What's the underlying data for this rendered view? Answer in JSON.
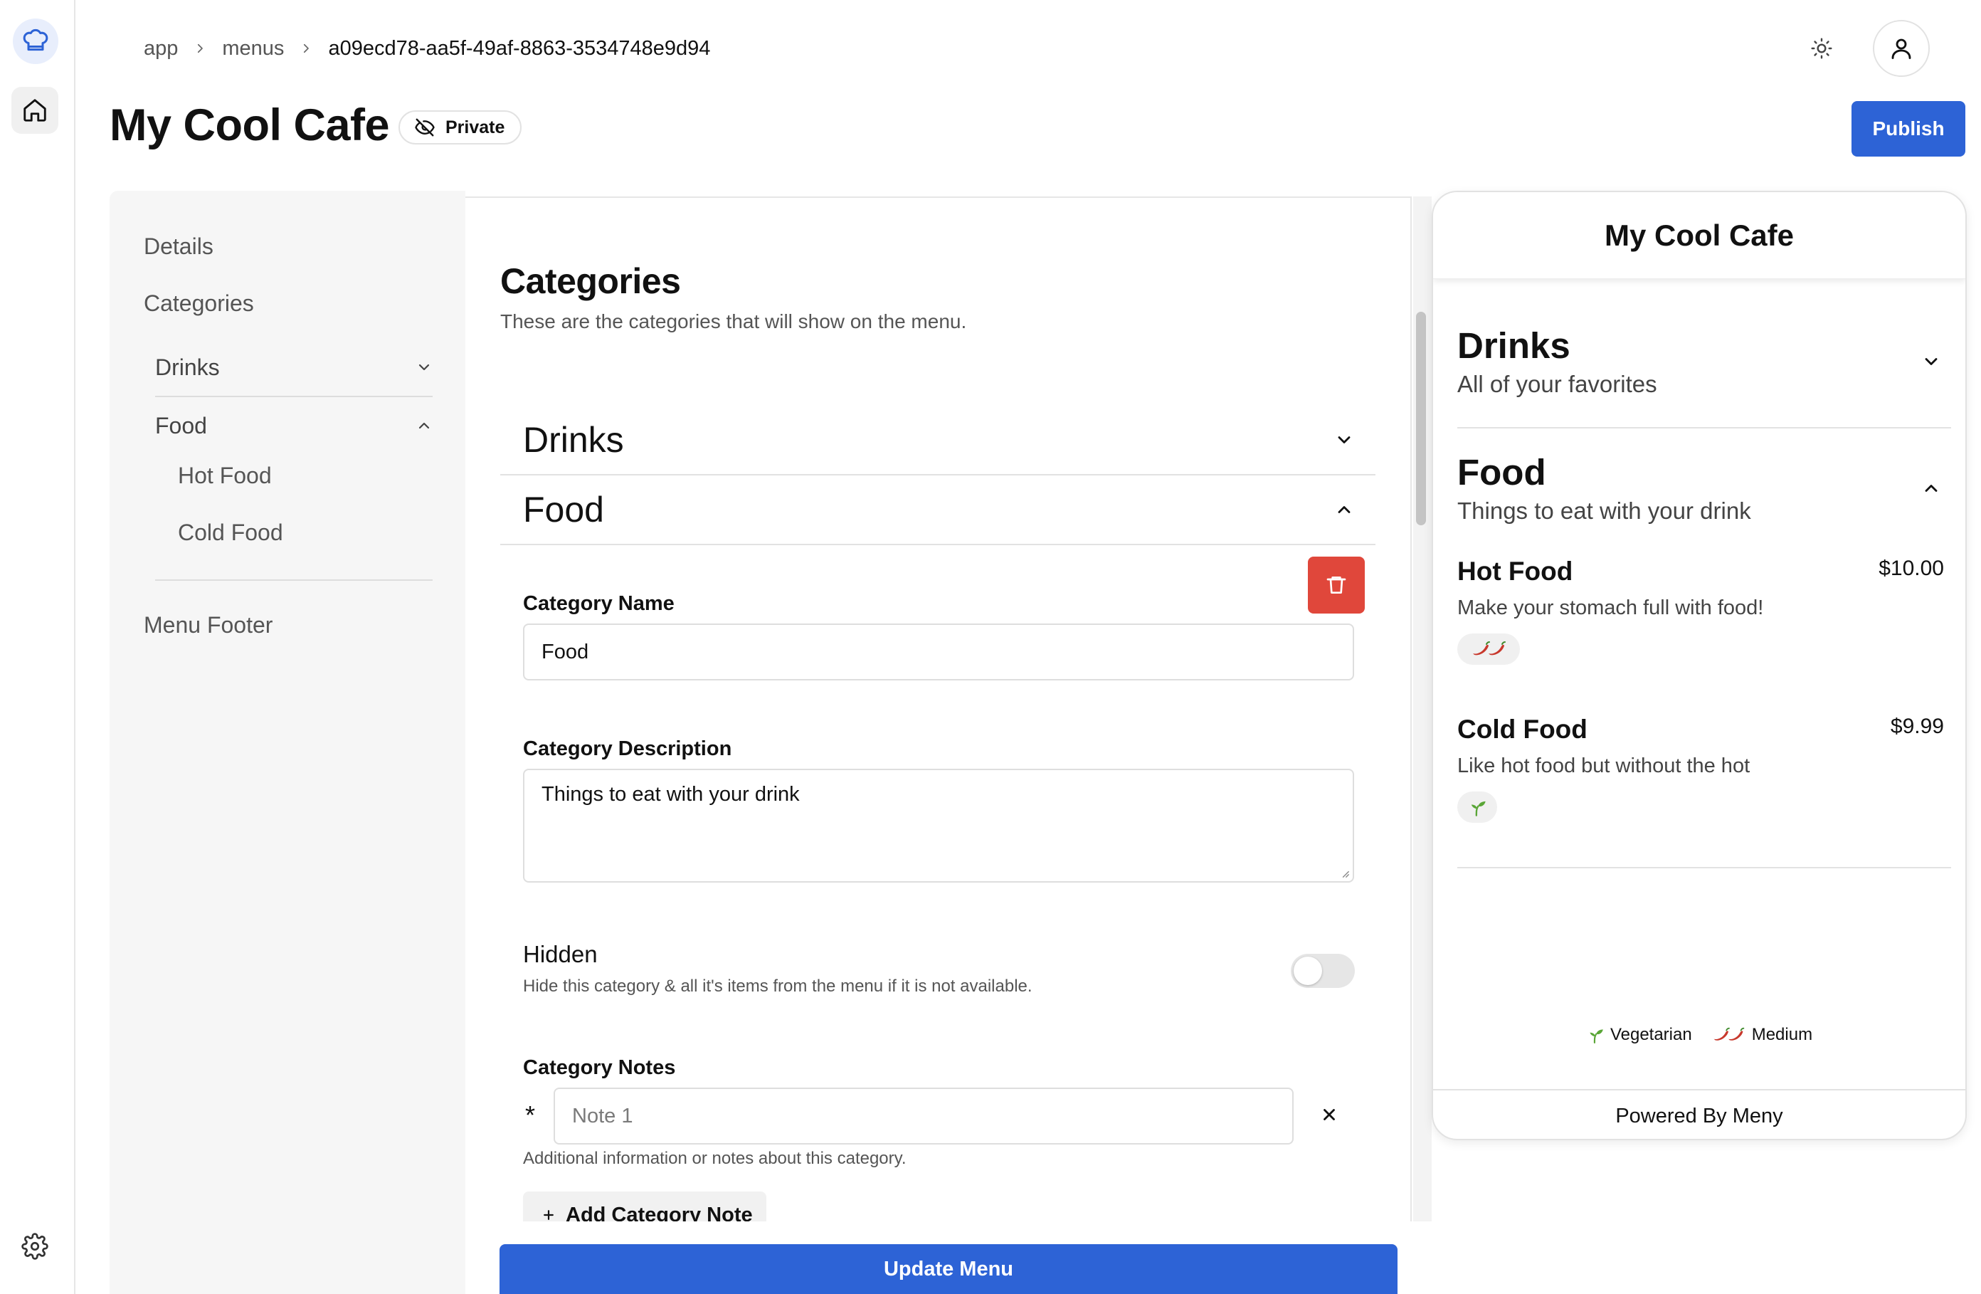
{
  "breadcrumb": {
    "items": [
      "app",
      "menus"
    ],
    "current": "a09ecd78-aa5f-49af-8863-3534748e9d94"
  },
  "header": {
    "title": "My Cool Cafe",
    "visibility_badge": "Private",
    "publish_label": "Publish"
  },
  "section_nav": {
    "details": "Details",
    "categories": "Categories",
    "drinks": "Drinks",
    "food": "Food",
    "hot_food": "Hot Food",
    "cold_food": "Cold Food",
    "menu_footer": "Menu Footer"
  },
  "editor": {
    "heading": "Categories",
    "subheading": "These are the categories that will show on the menu.",
    "accordion": [
      {
        "title": "Drinks",
        "expanded": false
      },
      {
        "title": "Food",
        "expanded": true
      }
    ],
    "category_name_label": "Category Name",
    "category_name_value": "Food",
    "category_description_label": "Category Description",
    "category_description_value": "Things to eat with your drink",
    "hidden_title": "Hidden",
    "hidden_description": "Hide this category & all it's items from the menu if it is not available.",
    "hidden_enabled": false,
    "notes_label": "Category Notes",
    "note_marker": "*",
    "note_placeholder": "Note 1",
    "notes_help": "Additional information or notes about this category.",
    "add_note_label": "Add Category Note",
    "update_label": "Update Menu"
  },
  "preview": {
    "title": "My Cool Cafe",
    "categories": [
      {
        "title": "Drinks",
        "description": "All of your favorites",
        "expanded": false
      },
      {
        "title": "Food",
        "description": "Things to eat with your drink",
        "expanded": true
      }
    ],
    "items": [
      {
        "name": "Hot Food",
        "price": "$10.00",
        "description": "Make your stomach full with food!",
        "tag": "chili-pepper-icon"
      },
      {
        "name": "Cold Food",
        "price": "$9.99",
        "description": "Like hot food but without the hot",
        "tag": "seedling-icon"
      }
    ],
    "legend": [
      {
        "label": "Vegetarian",
        "icon": "seedling-icon"
      },
      {
        "label": "Medium",
        "icon": "chili-pepper-icon"
      }
    ],
    "footer": "Powered By Meny"
  },
  "colors": {
    "accent": "#2d63d6",
    "danger": "#e0473b",
    "chili": "#c8382c",
    "leaf": "#5aa637"
  }
}
